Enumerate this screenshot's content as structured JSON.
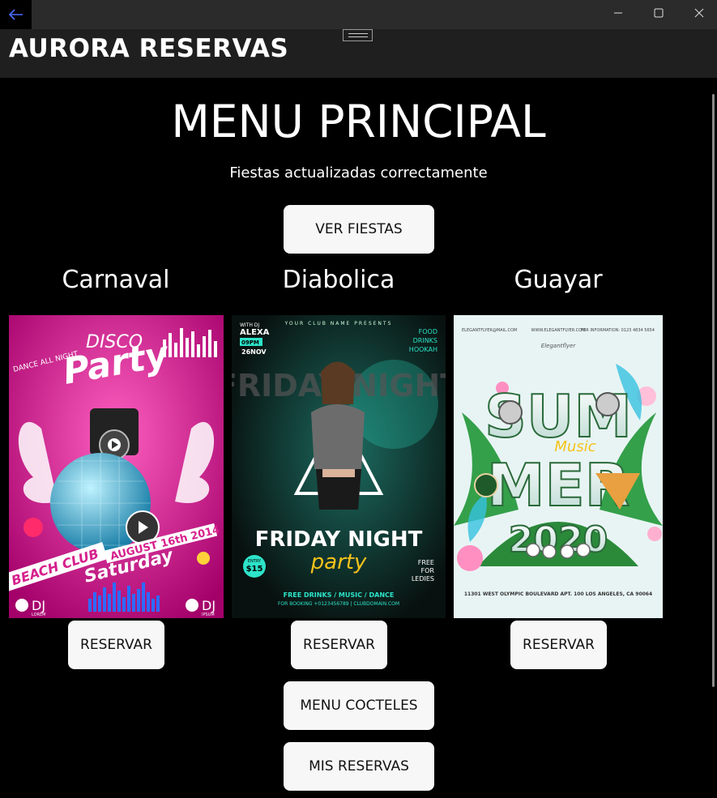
{
  "window": {
    "back_icon": "arrow-left-icon",
    "minimize_icon": "minimize-icon",
    "maximize_icon": "maximize-icon",
    "close_icon": "close-icon"
  },
  "header": {
    "title": "AURORA RESERVAS"
  },
  "main": {
    "title": "MENU PRINCIPAL",
    "status": "Fiestas actualizadas correctamente",
    "ver_fiestas_label": "VER FIESTAS",
    "menu_cocteles_label": "MENU COCTELES",
    "mis_reservas_label": "MIS RESERVAS"
  },
  "parties": [
    {
      "name": "Carnaval",
      "reserve_label": "RESERVAR",
      "poster": {
        "line1": "DANCE ALL NIGHT",
        "disco": "DISCO",
        "party": "Party",
        "date": "AUGUST 16th 2014",
        "beach": "BEACH CLUB",
        "day": "Saturday",
        "dj": "DJ",
        "dj1": "LOREM",
        "dj2": "IPSUM",
        "colors": {
          "bg": "#d6208c",
          "accent": "#ffffff"
        }
      }
    },
    {
      "name": "Diabolica",
      "reserve_label": "RESERVAR",
      "poster": {
        "with_dj": "WITH DJ",
        "dj_name": "ALEXA",
        "time": "09PM",
        "date": "26NOV",
        "club": "YOUR CLUB NAME PRESENTS",
        "food": "FOOD",
        "drinks": "DRINKS",
        "hookah": "HOOKAH",
        "bg_title": "FRIDAY NIGHT",
        "main_title": "FRIDAY NIGHT",
        "script": "party",
        "entry": "ENTRY",
        "price": "$15",
        "free1": "FREE",
        "free2": "FOR",
        "free3": "LEDIES",
        "offer": "FREE DRINKS / MUSIC / DANCE",
        "booking": "FOR BOOKING +0123456789 | CLUBDOMAIN.COM",
        "colors": {
          "bg": "#0c1a1a",
          "accent": "#2de3c8"
        }
      }
    },
    {
      "name": "Guayar",
      "reserve_label": "RESERVAR",
      "poster": {
        "email": "ELEGANTFLYER@MAIL.COM",
        "site": "WWW.ELEGANTFLYER.COM",
        "info": "FOR INFORMATION: 0123 4834 5654",
        "brand": "Elegantflyer",
        "sum": "SUM",
        "music": "Music",
        "mer": "MER",
        "year": "2020",
        "address": "11301 WEST OLYMPIC BOULEVARD APT. 100 LOS ANGELES, CA 90064",
        "colors": {
          "bg": "#e8f4f4",
          "accent": "#2a8a3a"
        }
      }
    }
  ]
}
